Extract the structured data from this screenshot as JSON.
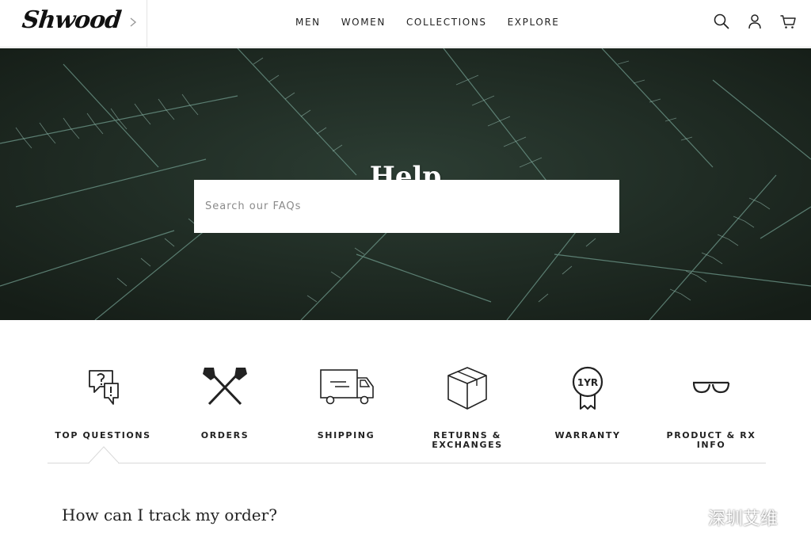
{
  "brand": {
    "logo_text": "Shwood"
  },
  "nav": {
    "items": [
      "MEN",
      "WOMEN",
      "COLLECTIONS",
      "EXPLORE"
    ]
  },
  "header_icons": [
    "search-icon",
    "account-icon",
    "cart-icon"
  ],
  "hero": {
    "title": "Help",
    "search_placeholder": "Search our FAQs"
  },
  "categories": [
    {
      "label": "TOP QUESTIONS",
      "icon": "question-bubbles-icon",
      "active": true
    },
    {
      "label": "ORDERS",
      "icon": "crossed-axes-icon"
    },
    {
      "label": "SHIPPING",
      "icon": "truck-icon"
    },
    {
      "label": "RETURNS & EXCHANGES",
      "icon": "box-icon"
    },
    {
      "label": "WARRANTY",
      "icon": "warranty-badge-icon",
      "badge_text": "1YR"
    },
    {
      "label": "PRODUCT & RX INFO",
      "icon": "glasses-icon"
    }
  ],
  "faq": {
    "question": "How can I track my order?"
  },
  "watermark": {
    "text": "深圳艾维"
  },
  "colors": {
    "hero_bg": "#1e2a22",
    "text": "#222222",
    "divider": "#d9d9d9"
  }
}
